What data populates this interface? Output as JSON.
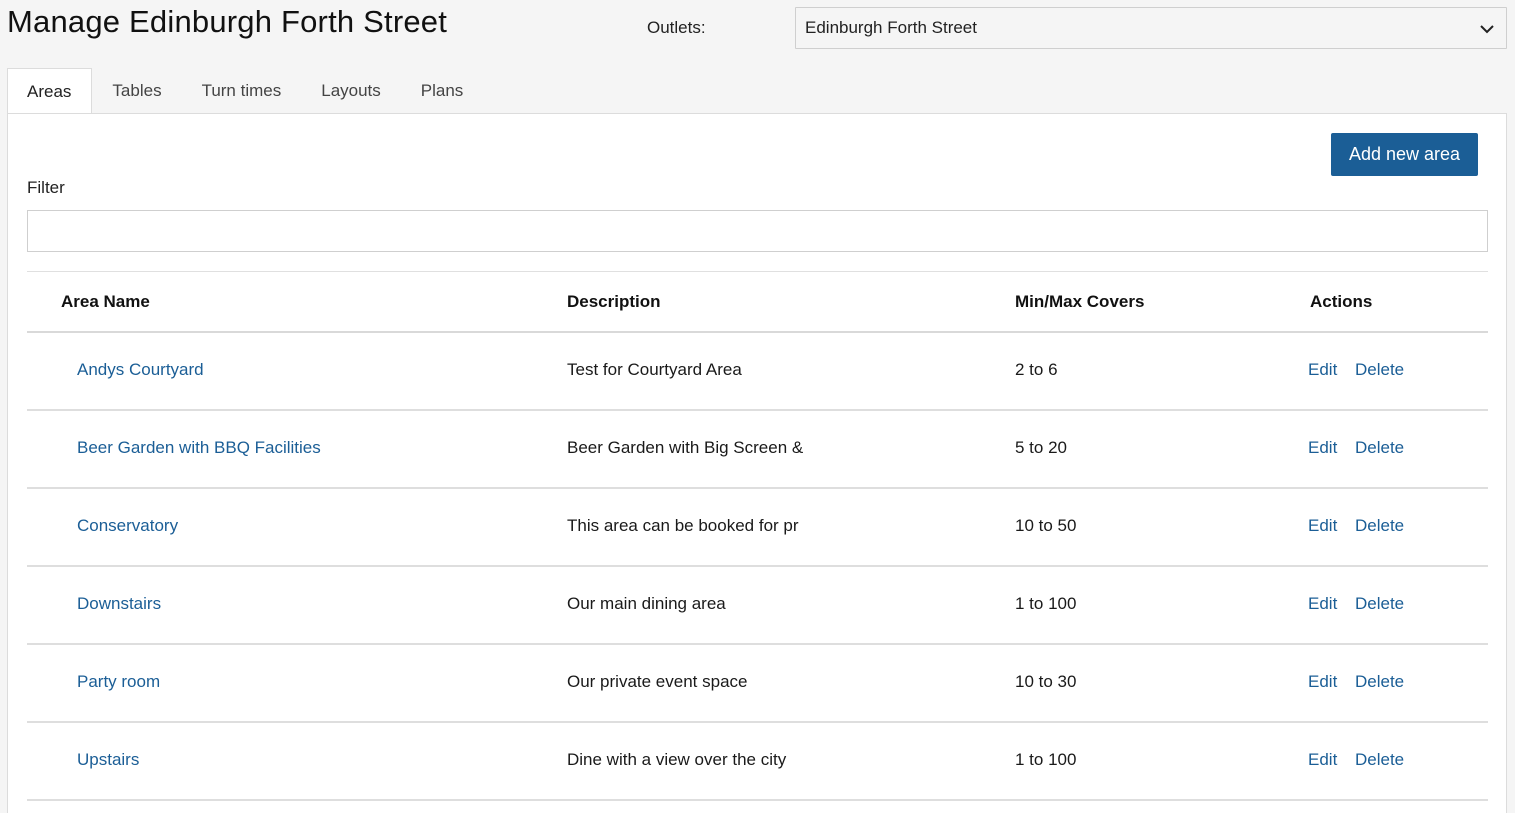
{
  "header": {
    "title": "Manage Edinburgh Forth Street",
    "outlets_label": "Outlets:",
    "outlet_selected": "Edinburgh Forth Street"
  },
  "tabs": [
    {
      "label": "Areas",
      "active": true
    },
    {
      "label": "Tables",
      "active": false
    },
    {
      "label": "Turn times",
      "active": false
    },
    {
      "label": "Layouts",
      "active": false
    },
    {
      "label": "Plans",
      "active": false
    }
  ],
  "toolbar": {
    "add_label": "Add new area"
  },
  "filter": {
    "label": "Filter",
    "value": "",
    "placeholder": ""
  },
  "table": {
    "columns": [
      "Area Name",
      "Description",
      "Min/Max Covers",
      "Actions"
    ],
    "rows": [
      {
        "name": "Andys Courtyard",
        "description": "Test for Courtyard Area",
        "covers": "2 to 6",
        "edit": "Edit",
        "delete": "Delete"
      },
      {
        "name": "Beer Garden with BBQ Facilities",
        "description": "Beer Garden with Big Screen &",
        "covers": "5 to 20",
        "edit": "Edit",
        "delete": "Delete"
      },
      {
        "name": "Conservatory",
        "description": "This area can be booked for pr",
        "covers": "10 to 50",
        "edit": "Edit",
        "delete": "Delete"
      },
      {
        "name": "Downstairs",
        "description": "Our main dining area",
        "covers": "1 to 100",
        "edit": "Edit",
        "delete": "Delete"
      },
      {
        "name": "Party room",
        "description": "Our private event space",
        "covers": "10 to 30",
        "edit": "Edit",
        "delete": "Delete"
      },
      {
        "name": "Upstairs",
        "description": "Dine with a view over the city",
        "covers": "1 to 100",
        "edit": "Edit",
        "delete": "Delete"
      }
    ]
  },
  "colors": {
    "accent": "#1b5e96",
    "link": "#1b5e96",
    "background": "#f5f5f5",
    "panel": "#ffffff"
  },
  "icons": {
    "outlet_select": "chevron-down-icon"
  }
}
